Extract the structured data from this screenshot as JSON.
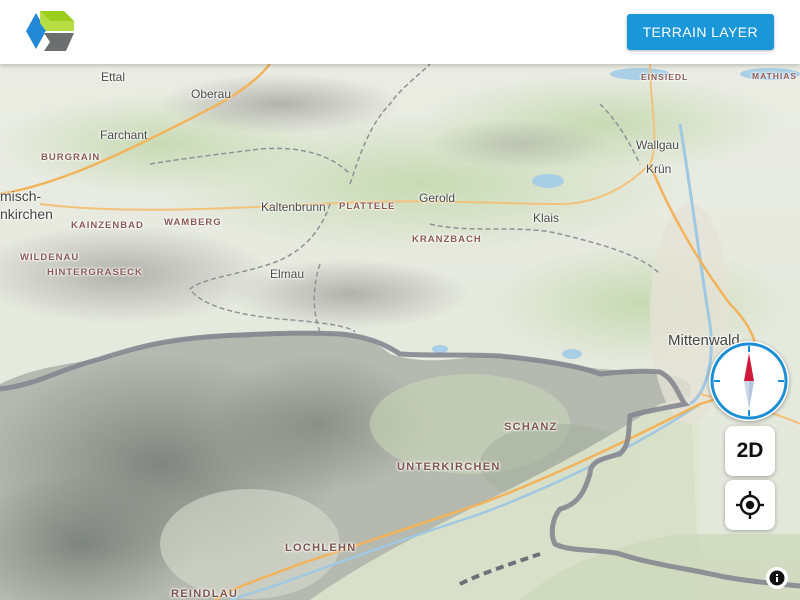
{
  "header": {
    "logo_icon": "cube-logo-icon",
    "terrain_button_label": "TERRAIN LAYER",
    "accent_color": "#1a97d8"
  },
  "map": {
    "view": "3D terrain",
    "places": [
      {
        "id": "ettal",
        "label": "Ettal"
      },
      {
        "id": "oberau",
        "label": "Oberau"
      },
      {
        "id": "farchant",
        "label": "Farchant"
      },
      {
        "id": "burgrain",
        "label": "BURGRAIN"
      },
      {
        "id": "garmisch1",
        "label": "misch-"
      },
      {
        "id": "garmisch2",
        "label": "nkirchen"
      },
      {
        "id": "kainzenbad",
        "label": "KAINZENBAD"
      },
      {
        "id": "wamberg",
        "label": "WAMBERG"
      },
      {
        "id": "wildenau",
        "label": "WILDENAU"
      },
      {
        "id": "hintergraseck",
        "label": "HINTERGRASECK"
      },
      {
        "id": "kaltenbrunn",
        "label": "Kaltenbrunn"
      },
      {
        "id": "plattele",
        "label": "PLATTELE"
      },
      {
        "id": "gerold",
        "label": "Gerold"
      },
      {
        "id": "kranzbach",
        "label": "KRANZBACH"
      },
      {
        "id": "klais",
        "label": "Klais"
      },
      {
        "id": "elmau",
        "label": "Elmau"
      },
      {
        "id": "einsiedl",
        "label": "EINSIEDL"
      },
      {
        "id": "mathias",
        "label": "MATHIAS"
      },
      {
        "id": "wallgau",
        "label": "Wallgau"
      },
      {
        "id": "krun",
        "label": "Krün"
      },
      {
        "id": "mittenwald",
        "label": "Mittenwald"
      },
      {
        "id": "schanz",
        "label": "SCHANZ"
      },
      {
        "id": "unterkirchen",
        "label": "UNTERKIRCHEN"
      },
      {
        "id": "lochlehn",
        "label": "LOCHLEHN"
      },
      {
        "id": "reindlau",
        "label": "REINDLAU"
      }
    ]
  },
  "controls": {
    "compass_icon": "compass-icon",
    "mode_button_label": "2D",
    "locate_icon": "crosshair-locate-icon",
    "info_icon": "info-icon",
    "compass_north_color": "#d0193a",
    "compass_ring_color": "#1a8fd6"
  }
}
